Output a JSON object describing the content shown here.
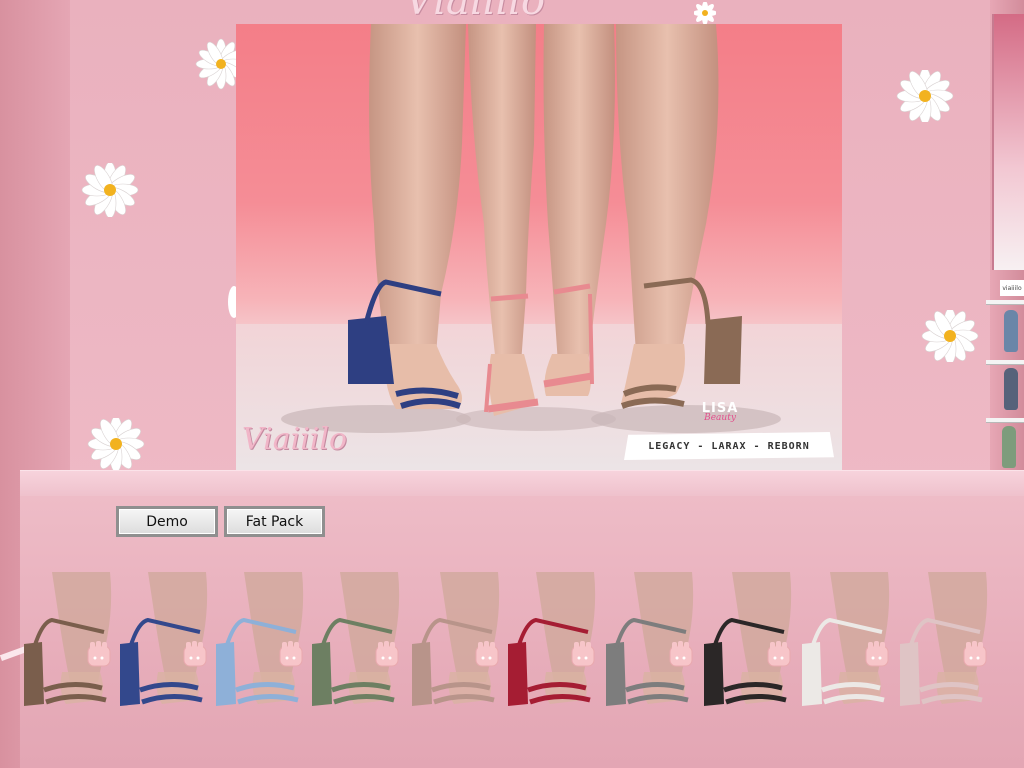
{
  "store": {
    "top_brand": "Viaiiilo",
    "poster_brand": "Viaiiilo",
    "lisa_logo_main": "LISA",
    "lisa_logo_sub": "Beauty",
    "bodies_banner": "LEGACY - LARAX - REBORN",
    "right_sign": "viaiiilo"
  },
  "buttons": {
    "demo_label": "Demo",
    "fatpack_label": "Fat Pack"
  },
  "colors": {
    "wall": "#e9aab8",
    "poster_pink": "#f47e88",
    "navy": "#2e3f82",
    "blush": "#e88a90",
    "tan": "#8a6a55"
  },
  "swatches": [
    {
      "name": "brown",
      "color": "#7a5e4c"
    },
    {
      "name": "navy",
      "color": "#33488c"
    },
    {
      "name": "baby-blue",
      "color": "#8eb0d8"
    },
    {
      "name": "olive",
      "color": "#6d7f62"
    },
    {
      "name": "nude",
      "color": "#b8948a"
    },
    {
      "name": "red",
      "color": "#a51d33"
    },
    {
      "name": "grey",
      "color": "#7d7d7d"
    },
    {
      "name": "black",
      "color": "#2b2727"
    },
    {
      "name": "white",
      "color": "#ece9e6"
    },
    {
      "name": "pale-pink",
      "color": "#dfc4c5"
    }
  ]
}
